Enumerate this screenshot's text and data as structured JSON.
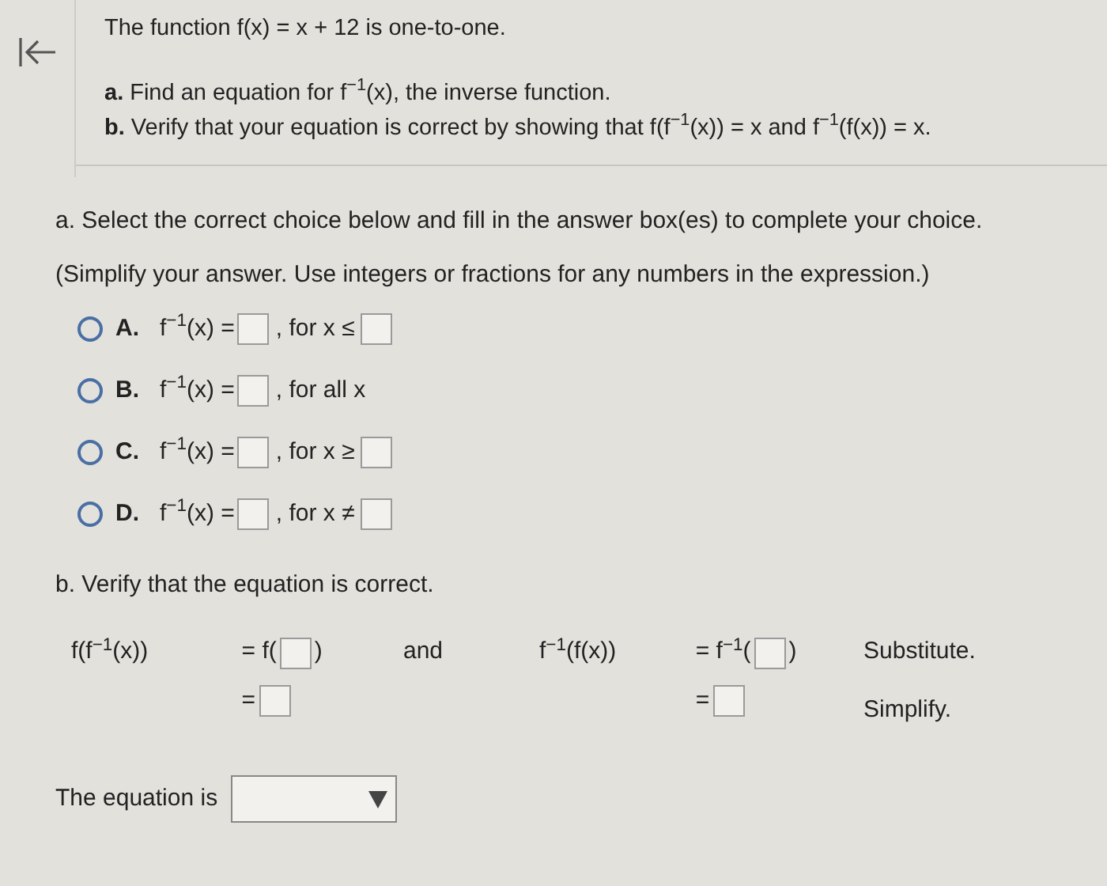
{
  "question": {
    "statement": "The function f(x) = x + 12 is one-to-one.",
    "parts": [
      {
        "label": "a.",
        "text": "Find an equation for f$^{−1}$(x), the inverse function."
      },
      {
        "label": "b.",
        "text": "Verify that your equation is correct by showing that f(f$^{−1}$(x)) = x and f$^{−1}$(f(x)) = x."
      }
    ]
  },
  "part_a": {
    "instruction": "a. Select the correct choice below and fill in the answer box(es) to complete your choice.",
    "hint": "(Simplify your answer. Use integers or fractions for any numbers in the expression.)",
    "choices": [
      {
        "label": "A.",
        "lhs": "f$^{−1}$(x) =",
        "condition": ", for x ≤",
        "kind": "bounded",
        "selected": false
      },
      {
        "label": "B.",
        "lhs": "f$^{−1}$(x) =",
        "condition": ", for all x",
        "kind": "unbounded",
        "selected": false
      },
      {
        "label": "C.",
        "lhs": "f$^{−1}$(x) =",
        "condition": ", for x ≥",
        "kind": "bounded",
        "selected": false
      },
      {
        "label": "D.",
        "lhs": "f$^{−1}$(x) =",
        "condition": ", for x ≠",
        "kind": "bounded",
        "selected": false
      }
    ]
  },
  "part_b": {
    "heading": "b. Verify that the equation is correct.",
    "left": {
      "lhs": "f(f$^{−1}$(x))",
      "steps": [
        {
          "prefix": "= f(",
          "suffix": ")"
        },
        {
          "prefix": "="
        }
      ]
    },
    "joiner": "and",
    "right": {
      "lhs": "f$^{−1}$(f(x))",
      "steps": [
        {
          "prefix": "= f$^{−1}$(",
          "suffix": ")"
        },
        {
          "prefix": "="
        }
      ]
    },
    "notes": [
      "Substitute.",
      "Simplify."
    ],
    "conclusion": {
      "label": "The equation is"
    }
  }
}
